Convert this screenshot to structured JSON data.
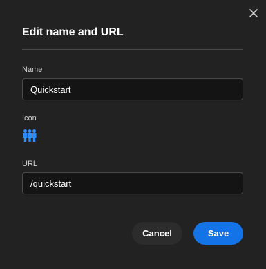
{
  "dialog": {
    "title": "Edit name and URL",
    "close_icon": "close-icon"
  },
  "fields": {
    "name": {
      "label": "Name",
      "value": "Quickstart"
    },
    "icon": {
      "label": "Icon",
      "icon_name": "user-group-icon",
      "icon_color": "#2d8cff"
    },
    "url": {
      "label": "URL",
      "value": "/quickstart"
    }
  },
  "actions": {
    "cancel_label": "Cancel",
    "save_label": "Save"
  },
  "colors": {
    "accent": "#1473e6",
    "dialog_bg": "#222222",
    "input_bg": "#141414"
  }
}
